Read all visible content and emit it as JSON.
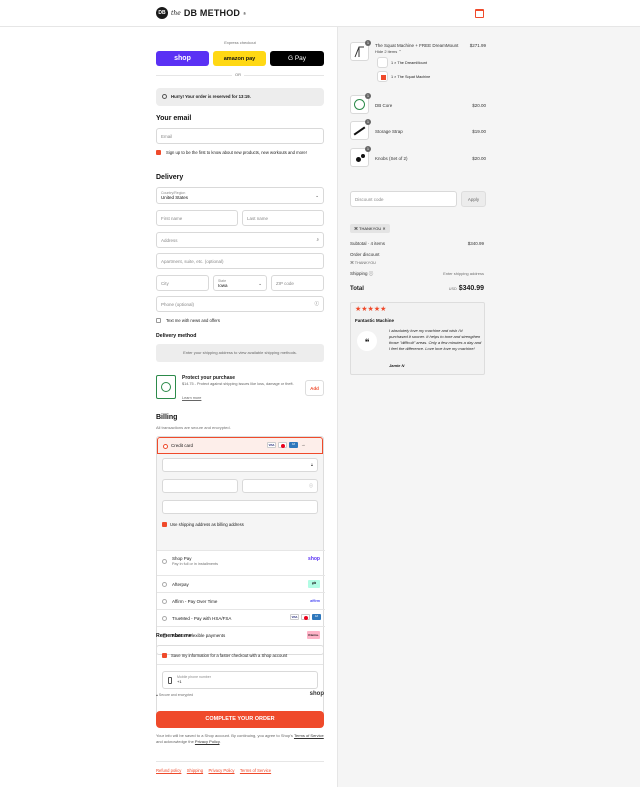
{
  "header": {
    "logo_mark": "DB",
    "logo_prefix": "the",
    "logo_text": "DB METHOD",
    "logo_suffix": "®"
  },
  "express": {
    "label": "Express checkout",
    "shop": "shop",
    "amazon": "amazon pay",
    "gpay": "G Pay",
    "or": "OR"
  },
  "reserve": {
    "text": "Hurry! Your order is reserved for 13:19."
  },
  "email": {
    "title": "Your email",
    "placeholder": "Email",
    "newsletter": "Sign up to be the first to know about new products, new workouts and more!"
  },
  "delivery": {
    "title": "Delivery",
    "country_label": "Country/Region",
    "country": "United States",
    "first_name": "First name",
    "last_name": "Last name",
    "address": "Address",
    "apartment": "Apartment, suite, etc. (optional)",
    "city": "City",
    "state_label": "State",
    "state": "Iowa",
    "zip": "ZIP code",
    "phone": "Phone (optional)",
    "text_news": "Text me with news and offers",
    "method_title": "Delivery method",
    "method_text": "Enter your shipping address to view available shipping methods."
  },
  "protect": {
    "title": "Protect your purchase",
    "text": "$14.75 - Protect against shipping issues like loss, damage or theft.",
    "learn": "Learn more",
    "add": "Add"
  },
  "billing": {
    "title": "Billing",
    "subtitle": "All transactions are secure and encrypted.",
    "credit_card": "Credit card",
    "same_address": "Use shipping address as billing address",
    "shop_pay": "Shop Pay",
    "shop_pay_sub": "Pay in full or in installments",
    "shop_pay_logo": "shop",
    "afterpay": "Afterpay",
    "affirm": "Affirm - Pay Over Time",
    "affirm_logo": "affirm",
    "truemed": "TrueMed - Pay with HSA/FSA",
    "klarna": "Klarna - Flexible payments",
    "klarna_logo": "Klarna."
  },
  "remember": {
    "title": "Remember me",
    "save": "Save my information for a faster checkout with a Shop account",
    "phone_label": "Mobile phone number",
    "phone_value": "+1",
    "secure": "Secure and encrypted",
    "shop_logo": "shop"
  },
  "complete": {
    "label": "COMPLETE YOUR ORDER"
  },
  "legal": {
    "text1": "Your info will be saved to a Shop account. By continuing, you agree to Shop's ",
    "terms": "Terms of Service",
    "text2": " and acknowledge the ",
    "privacy": "Privacy Policy",
    "text3": "."
  },
  "footer": {
    "links": [
      "Refund policy",
      "Shipping",
      "Privacy Policy",
      "Terms of Service"
    ]
  },
  "cart": {
    "items": [
      {
        "name": "The Squat Machine + FREE DreamMount",
        "price": "$271.99",
        "qty": "1",
        "hide": "Hide 2 items"
      },
      {
        "name": "DB Core",
        "price": "$20.00",
        "qty": "1"
      },
      {
        "name": "Storage Strap",
        "price": "$19.00",
        "qty": "1"
      },
      {
        "name": "Knobs (Set of 2)",
        "price": "$20.00",
        "qty": "1"
      }
    ],
    "sub_items": [
      "1 × The DreamMount",
      "1 × The Squat Machine"
    ],
    "discount_placeholder": "Discount code",
    "apply": "Apply",
    "code_tag": "THANKYOU",
    "subtotal_label": "Subtotal · 4 items",
    "subtotal": "$340.99",
    "order_discount": "Order discount",
    "discount_code": "THANKYOU",
    "shipping_label": "Shipping",
    "shipping_value": "Enter shipping address",
    "total_label": "Total",
    "currency": "USD",
    "total": "$340.99"
  },
  "review": {
    "stars": "★★★★★",
    "title": "Fantastic Machine",
    "quote_icon": "❝",
    "text": "I absolutely love my machine and wish I'd purchased it sooner. It helps to tone and strengthen those \"difficult\" areas. Only a few minutes a day and I feel the difference. Love love love my machine!",
    "author": "Jamie N"
  },
  "colors": {
    "accent": "#ef4a2b",
    "shop": "#5a31f4",
    "amazon": "#ffd814"
  }
}
